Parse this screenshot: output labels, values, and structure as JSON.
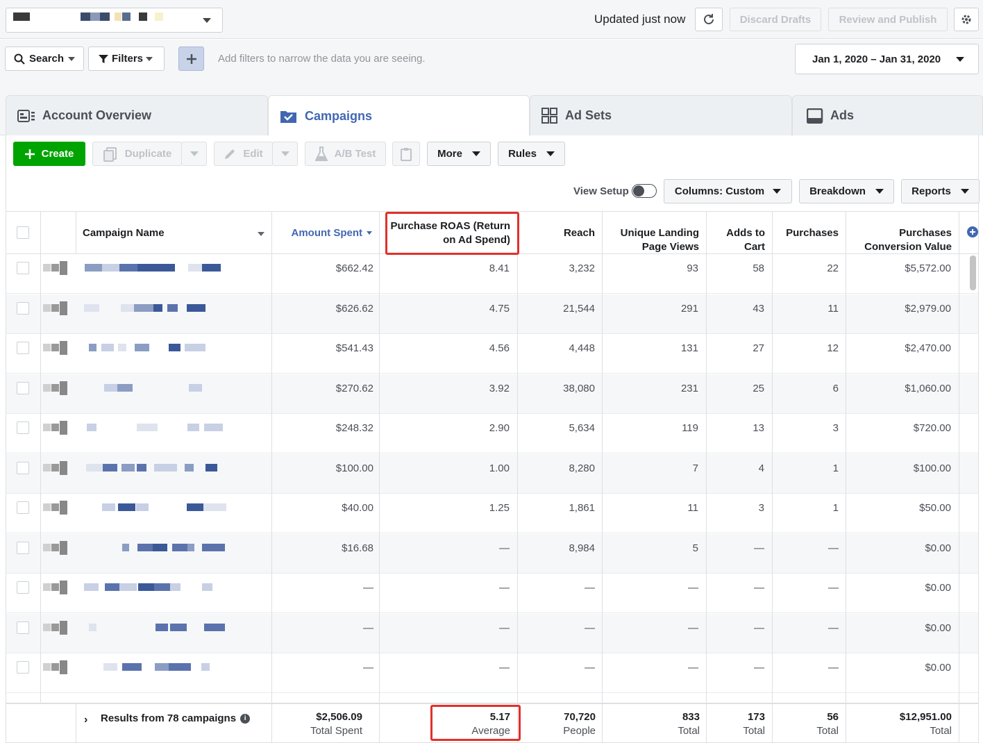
{
  "topbar": {
    "updated_text": "Updated just now",
    "discard_label": "Discard Drafts",
    "review_label": "Review and Publish"
  },
  "filters": {
    "search_label": "Search",
    "filters_label": "Filters",
    "hint": "Add filters to narrow the data you are seeing.",
    "date_range": "Jan 1, 2020 – Jan 31, 2020"
  },
  "tabs": [
    {
      "label": "Account Overview",
      "icon": "account-overview-icon"
    },
    {
      "label": "Campaigns",
      "icon": "campaigns-folder-icon"
    },
    {
      "label": "Ad Sets",
      "icon": "ad-sets-grid-icon"
    },
    {
      "label": "Ads",
      "icon": "ads-icon"
    }
  ],
  "toolbar": {
    "create_label": "Create",
    "duplicate_label": "Duplicate",
    "edit_label": "Edit",
    "ab_test_label": "A/B Test",
    "more_label": "More",
    "rules_label": "Rules",
    "view_setup_label": "View Setup",
    "columns_prefix": "Columns:",
    "columns_value": "Custom",
    "breakdown_label": "Breakdown",
    "reports_label": "Reports"
  },
  "table": {
    "headers": {
      "campaign_name": "Campaign Name",
      "amount_spent": "Amount Spent",
      "roas_line1": "Purchase ROAS (Return",
      "roas_line2": "on Ad Spend)",
      "reach": "Reach",
      "landing_line1": "Unique Landing",
      "landing_line2": "Page Views",
      "cart_line1": "Adds to",
      "cart_line2": "Cart",
      "purchases": "Purchases",
      "pcv_line1": "Purchases",
      "pcv_line2": "Conversion Value"
    },
    "rows": [
      {
        "spent": "$662.42",
        "roas": "8.41",
        "reach": "3,232",
        "landing": "93",
        "cart": "58",
        "purchases": "22",
        "value": "$5,572.00"
      },
      {
        "spent": "$626.62",
        "roas": "4.75",
        "reach": "21,544",
        "landing": "291",
        "cart": "43",
        "purchases": "11",
        "value": "$2,979.00"
      },
      {
        "spent": "$541.43",
        "roas": "4.56",
        "reach": "4,448",
        "landing": "131",
        "cart": "27",
        "purchases": "12",
        "value": "$2,470.00"
      },
      {
        "spent": "$270.62",
        "roas": "3.92",
        "reach": "38,080",
        "landing": "231",
        "cart": "25",
        "purchases": "6",
        "value": "$1,060.00"
      },
      {
        "spent": "$248.32",
        "roas": "2.90",
        "reach": "5,634",
        "landing": "119",
        "cart": "13",
        "purchases": "3",
        "value": "$720.00"
      },
      {
        "spent": "$100.00",
        "roas": "1.00",
        "reach": "8,280",
        "landing": "7",
        "cart": "4",
        "purchases": "1",
        "value": "$100.00"
      },
      {
        "spent": "$40.00",
        "roas": "1.25",
        "reach": "1,861",
        "landing": "11",
        "cart": "3",
        "purchases": "1",
        "value": "$50.00"
      },
      {
        "spent": "$16.68",
        "roas": "—",
        "reach": "8,984",
        "landing": "5",
        "cart": "—",
        "purchases": "—",
        "value": "$0.00"
      },
      {
        "spent": "—",
        "roas": "—",
        "reach": "—",
        "landing": "—",
        "cart": "—",
        "purchases": "—",
        "value": "$0.00"
      },
      {
        "spent": "—",
        "roas": "—",
        "reach": "—",
        "landing": "—",
        "cart": "—",
        "purchases": "—",
        "value": "$0.00"
      },
      {
        "spent": "—",
        "roas": "—",
        "reach": "—",
        "landing": "—",
        "cart": "—",
        "purchases": "—",
        "value": "$0.00"
      }
    ],
    "footer": {
      "results_label": "Results from 78 campaigns",
      "spent_value": "$2,506.09",
      "spent_label": "Total Spent",
      "roas_value": "5.17",
      "roas_label": "Average",
      "reach_value": "70,720",
      "reach_label": "People",
      "landing_value": "833",
      "landing_label": "Total",
      "cart_value": "173",
      "cart_label": "Total",
      "purchases_value": "56",
      "purchases_label": "Total",
      "pcv_value": "$12,951.00",
      "pcv_label": "Total"
    }
  },
  "colors": {
    "accent": "#4267b2",
    "create_green": "#00a400",
    "highlight_red": "#e0312c"
  }
}
